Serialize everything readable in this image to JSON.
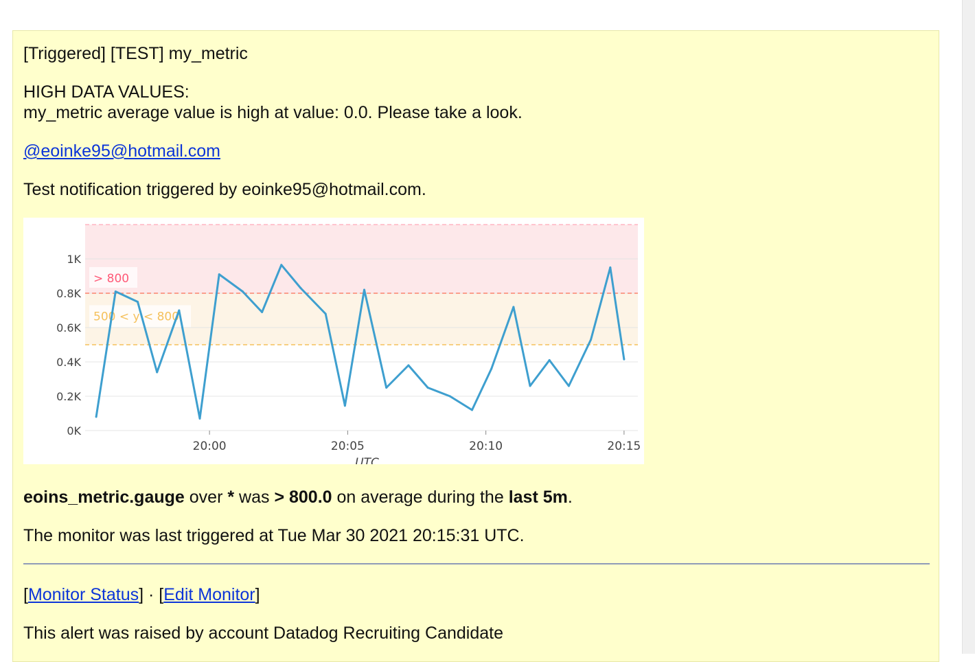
{
  "alert": {
    "subject": "[Triggered] [TEST] my_metric",
    "heading": "HIGH DATA VALUES:",
    "message": "my_metric average value is high at value: 0.0. Please take a look.",
    "mention": "@eoinke95@hotmail.com",
    "test_note": "Test notification triggered by eoinke95@hotmail.com."
  },
  "summary": {
    "metric": "eoins_metric.gauge",
    "over": " over ",
    "scope": "*",
    "was": " was ",
    "threshold": "> 800.0",
    "on_avg": " on average during the ",
    "window": "last 5m",
    "end": "."
  },
  "last_triggered": "The monitor was last triggered at Tue Mar 30 2021 20:15:31 UTC.",
  "links": {
    "open1": "[",
    "monitor_status": "Monitor Status",
    "sep": "] · [",
    "edit_monitor": "Edit Monitor",
    "close": "]"
  },
  "footer": "This alert was raised by account Datadog Recruiting Candidate",
  "chart_data": {
    "type": "line",
    "xlabel": "UTC",
    "ylabel": "",
    "ylim": [
      0,
      1200
    ],
    "y_ticks": [
      0,
      200,
      400,
      600,
      800,
      1000
    ],
    "y_tick_labels": [
      "0K",
      "0.2K",
      "0.4K",
      "0.6K",
      "0.8K",
      "1K"
    ],
    "x_ticks": [
      "20:00",
      "20:05",
      "20:10",
      "20:15"
    ],
    "x_tick_minutes": [
      0,
      5,
      10,
      15
    ],
    "xlim_minutes": [
      -4.5,
      15.5
    ],
    "thresholds": [
      {
        "label": "> 800",
        "from": 800,
        "to": 1200,
        "color": "#ff5a78",
        "fill": "#fde8ea"
      },
      {
        "label": "500 < y < 800",
        "from": 500,
        "to": 800,
        "color": "#f5c15c",
        "fill": "#fdf4e6"
      }
    ],
    "series": [
      {
        "color": "#3e9fcf",
        "x_minutes": [
          -4.1,
          -3.4,
          -2.6,
          -1.9,
          -1.1,
          -0.35,
          0.35,
          1.2,
          1.9,
          2.6,
          3.3,
          4.2,
          4.9,
          5.6,
          6.4,
          7.2,
          7.9,
          8.7,
          9.5,
          10.2,
          11.0,
          11.6,
          12.3,
          13.0,
          13.8,
          14.5,
          15.0
        ],
        "values": [
          80,
          810,
          750,
          340,
          700,
          70,
          910,
          810,
          690,
          965,
          830,
          680,
          145,
          820,
          250,
          380,
          250,
          200,
          120,
          360,
          720,
          260,
          410,
          260,
          530,
          950,
          415
        ]
      }
    ]
  }
}
